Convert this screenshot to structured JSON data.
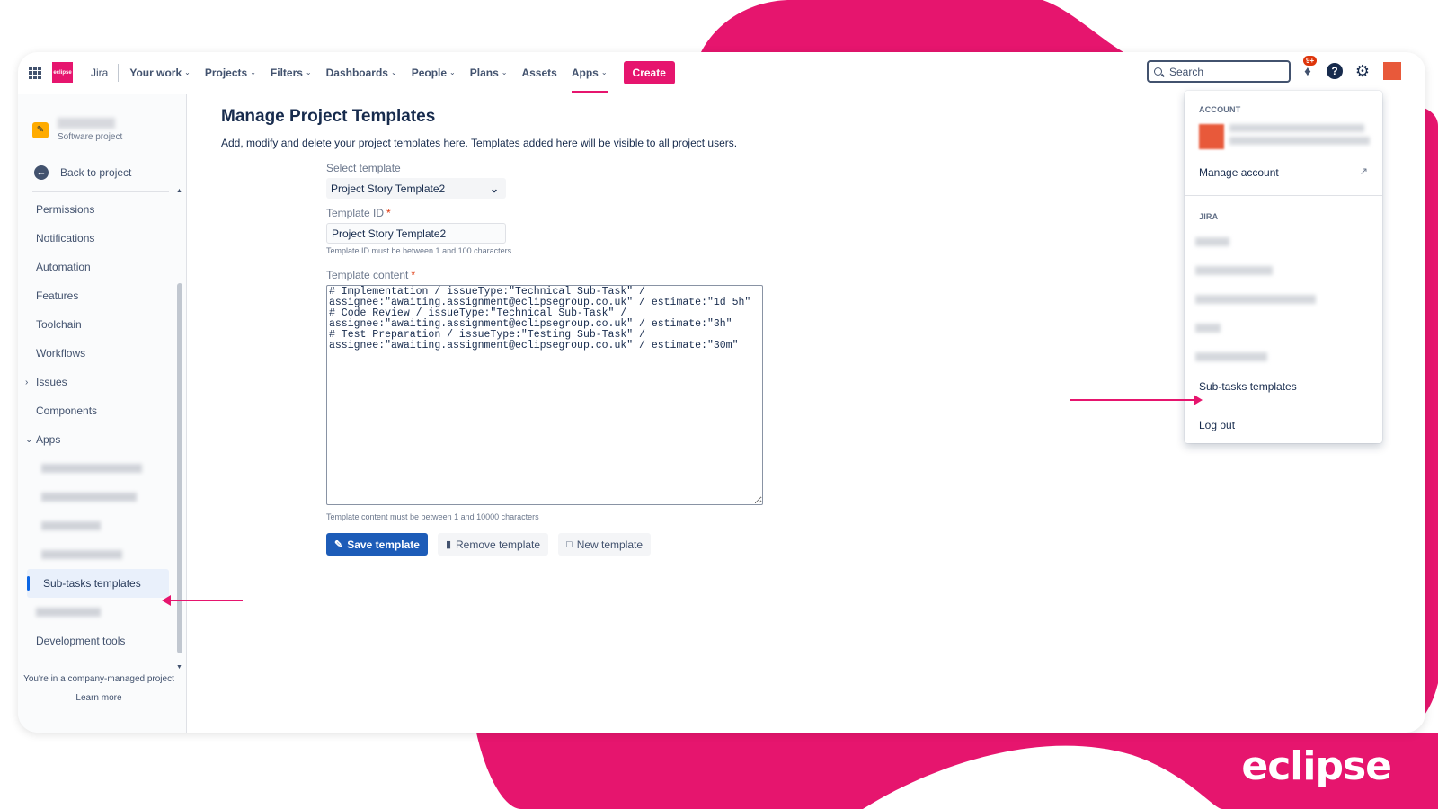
{
  "colors": {
    "brand": "#e6156e",
    "primary_button": "#1d5cb8",
    "text": "#172b4d",
    "muted": "#6b778c"
  },
  "brand_logo": "eclipse",
  "topnav": {
    "logo_text": "eclipse",
    "product": "Jira",
    "items": [
      {
        "label": "Your work",
        "chevron": true
      },
      {
        "label": "Projects",
        "chevron": true
      },
      {
        "label": "Filters",
        "chevron": true
      },
      {
        "label": "Dashboards",
        "chevron": true
      },
      {
        "label": "People",
        "chevron": true
      },
      {
        "label": "Plans",
        "chevron": true
      },
      {
        "label": "Assets",
        "chevron": false
      },
      {
        "label": "Apps",
        "chevron": true,
        "active": true
      }
    ],
    "create_label": "Create",
    "search_placeholder": "Search",
    "notification_badge": "9+"
  },
  "sidebar": {
    "project_type": "Software project",
    "back_label": "Back to project",
    "items": [
      "Permissions",
      "Notifications",
      "Automation",
      "Features",
      "Toolchain",
      "Workflows",
      "Issues",
      "Components",
      "Apps"
    ],
    "selected_item": "Sub-tasks templates",
    "dev_tools": "Development tools",
    "footer_text": "You're in a company-managed project",
    "footer_link": "Learn more"
  },
  "main": {
    "title": "Manage Project Templates",
    "description": "Add, modify and delete your project templates here. Templates added here will be visible to all project users.",
    "select_label": "Select template",
    "select_value": "Project Story Template2",
    "id_label": "Template ID",
    "id_value": "Project Story Template2",
    "id_helper": "Template ID must be between 1 and 100 characters",
    "content_label": "Template content",
    "content_value": "# Implementation / issueType:\"Technical Sub-Task\" /\nassignee:\"awaiting.assignment@eclipsegroup.co.uk\" / estimate:\"1d 5h\"\n# Code Review / issueType:\"Technical Sub-Task\" /\nassignee:\"awaiting.assignment@eclipsegroup.co.uk\" / estimate:\"3h\"\n# Test Preparation / issueType:\"Testing Sub-Task\" /\nassignee:\"awaiting.assignment@eclipsegroup.co.uk\" / estimate:\"30m\"",
    "content_helper": "Template content must be between 1 and 10000 characters",
    "save_label": "Save template",
    "remove_label": "Remove template",
    "new_label": "New template"
  },
  "dropdown": {
    "account_heading": "ACCOUNT",
    "manage_account": "Manage account",
    "jira_heading": "JIRA",
    "subtasks_templates": "Sub-tasks templates",
    "log_out": "Log out"
  }
}
